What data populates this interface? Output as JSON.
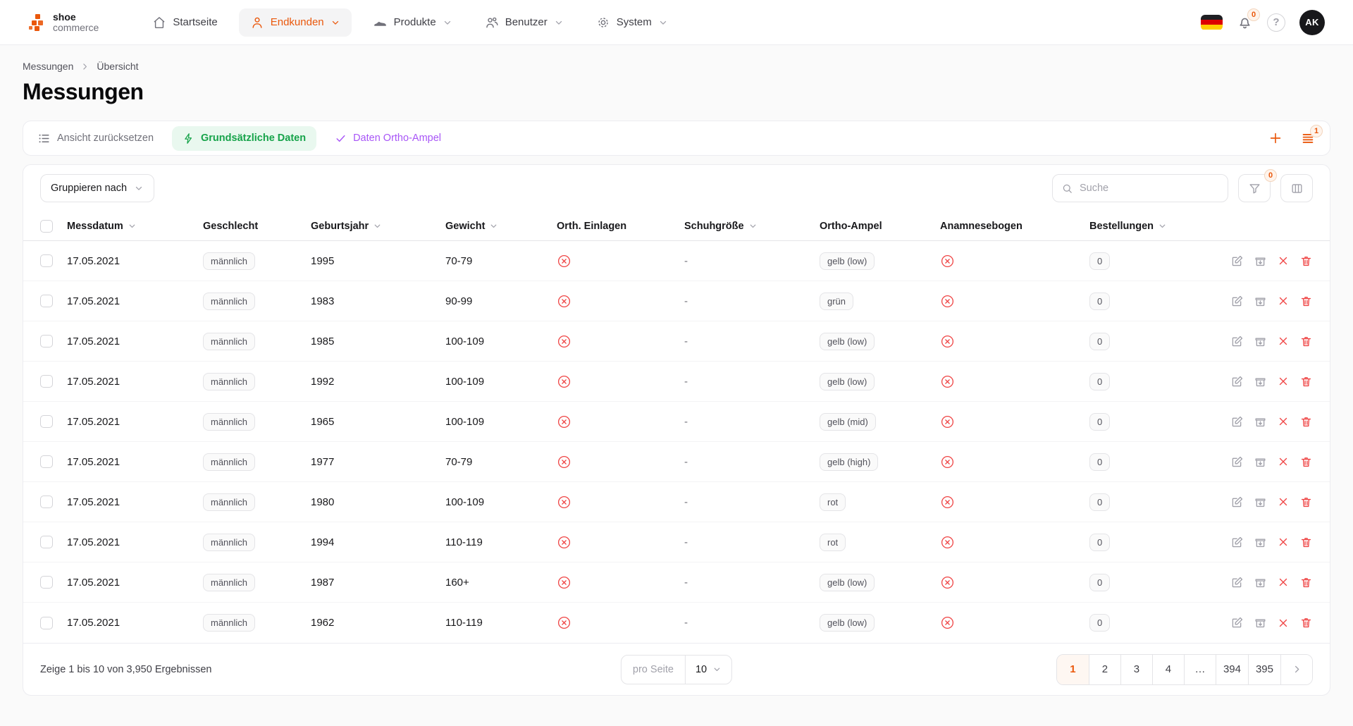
{
  "colors": {
    "accent_orange": "#ea580c",
    "green": "#16a34a",
    "green_bg": "#e9f8ef",
    "purple": "#a855f7",
    "red": "#ef4444",
    "page_bg": "#fafafa"
  },
  "brand": {
    "line1": "shoe",
    "line2": "commerce"
  },
  "nav": {
    "items": [
      {
        "label": "Startseite",
        "icon": "home",
        "active": false
      },
      {
        "label": "Endkunden",
        "icon": "person",
        "active": true
      },
      {
        "label": "Produkte",
        "icon": "shoe",
        "active": false
      },
      {
        "label": "Benutzer",
        "icon": "users",
        "active": false
      },
      {
        "label": "System",
        "icon": "gear",
        "active": false
      }
    ]
  },
  "topbar": {
    "notifications_badge": "0",
    "avatar_initials": "AK"
  },
  "breadcrumb": {
    "level1": "Messungen",
    "level2": "Übersicht"
  },
  "page": {
    "title": "Messungen"
  },
  "view_toolbar": {
    "reset_label": "Ansicht zurücksetzen",
    "view_basic_label": "Grundsätzliche Daten",
    "view_ortho_label": "Daten Ortho-Ampel",
    "views_badge": "1"
  },
  "controls": {
    "group_by_label": "Gruppieren nach",
    "search_placeholder": "Suche",
    "filter_badge": "0"
  },
  "table": {
    "columns": [
      {
        "label": "Messdatum",
        "sortable": true
      },
      {
        "label": "Geschlecht",
        "sortable": false
      },
      {
        "label": "Geburtsjahr",
        "sortable": true
      },
      {
        "label": "Gewicht",
        "sortable": true
      },
      {
        "label": "Orth. Einlagen",
        "sortable": false
      },
      {
        "label": "Schuhgröße",
        "sortable": true
      },
      {
        "label": "Ortho-Ampel",
        "sortable": false
      },
      {
        "label": "Anamnesebogen",
        "sortable": false
      },
      {
        "label": "Bestellungen",
        "sortable": true
      }
    ],
    "rows": [
      {
        "date": "17.05.2021",
        "gender": "männlich",
        "year": "1995",
        "weight": "70-79",
        "orth_einlagen_icon": "circle-x",
        "shoe_size": "-",
        "ampel": "gelb (low)",
        "anamnese_icon": "circle-x",
        "orders": "0"
      },
      {
        "date": "17.05.2021",
        "gender": "männlich",
        "year": "1983",
        "weight": "90-99",
        "orth_einlagen_icon": "circle-x",
        "shoe_size": "-",
        "ampel": "grün",
        "anamnese_icon": "circle-x",
        "orders": "0"
      },
      {
        "date": "17.05.2021",
        "gender": "männlich",
        "year": "1985",
        "weight": "100-109",
        "orth_einlagen_icon": "circle-x",
        "shoe_size": "-",
        "ampel": "gelb (low)",
        "anamnese_icon": "circle-x",
        "orders": "0"
      },
      {
        "date": "17.05.2021",
        "gender": "männlich",
        "year": "1992",
        "weight": "100-109",
        "orth_einlagen_icon": "circle-x",
        "shoe_size": "-",
        "ampel": "gelb (low)",
        "anamnese_icon": "circle-x",
        "orders": "0"
      },
      {
        "date": "17.05.2021",
        "gender": "männlich",
        "year": "1965",
        "weight": "100-109",
        "orth_einlagen_icon": "circle-x",
        "shoe_size": "-",
        "ampel": "gelb (mid)",
        "anamnese_icon": "circle-x",
        "orders": "0"
      },
      {
        "date": "17.05.2021",
        "gender": "männlich",
        "year": "1977",
        "weight": "70-79",
        "orth_einlagen_icon": "circle-x",
        "shoe_size": "-",
        "ampel": "gelb (high)",
        "anamnese_icon": "circle-x",
        "orders": "0"
      },
      {
        "date": "17.05.2021",
        "gender": "männlich",
        "year": "1980",
        "weight": "100-109",
        "orth_einlagen_icon": "circle-x",
        "shoe_size": "-",
        "ampel": "rot",
        "anamnese_icon": "circle-x",
        "orders": "0"
      },
      {
        "date": "17.05.2021",
        "gender": "männlich",
        "year": "1994",
        "weight": "110-119",
        "orth_einlagen_icon": "circle-x",
        "shoe_size": "-",
        "ampel": "rot",
        "anamnese_icon": "circle-x",
        "orders": "0"
      },
      {
        "date": "17.05.2021",
        "gender": "männlich",
        "year": "1987",
        "weight": "160+",
        "orth_einlagen_icon": "circle-x",
        "shoe_size": "-",
        "ampel": "gelb (low)",
        "anamnese_icon": "circle-x",
        "orders": "0"
      },
      {
        "date": "17.05.2021",
        "gender": "männlich",
        "year": "1962",
        "weight": "110-119",
        "orth_einlagen_icon": "circle-x",
        "shoe_size": "-",
        "ampel": "gelb (low)",
        "anamnese_icon": "circle-x",
        "orders": "0"
      }
    ]
  },
  "footer": {
    "results_text": "Zeige 1 bis 10 von 3,950 Ergebnissen",
    "per_page_label": "pro Seite",
    "per_page_value": "10",
    "pages": [
      "1",
      "2",
      "3",
      "4",
      "…",
      "394",
      "395"
    ],
    "active_page": "1"
  }
}
